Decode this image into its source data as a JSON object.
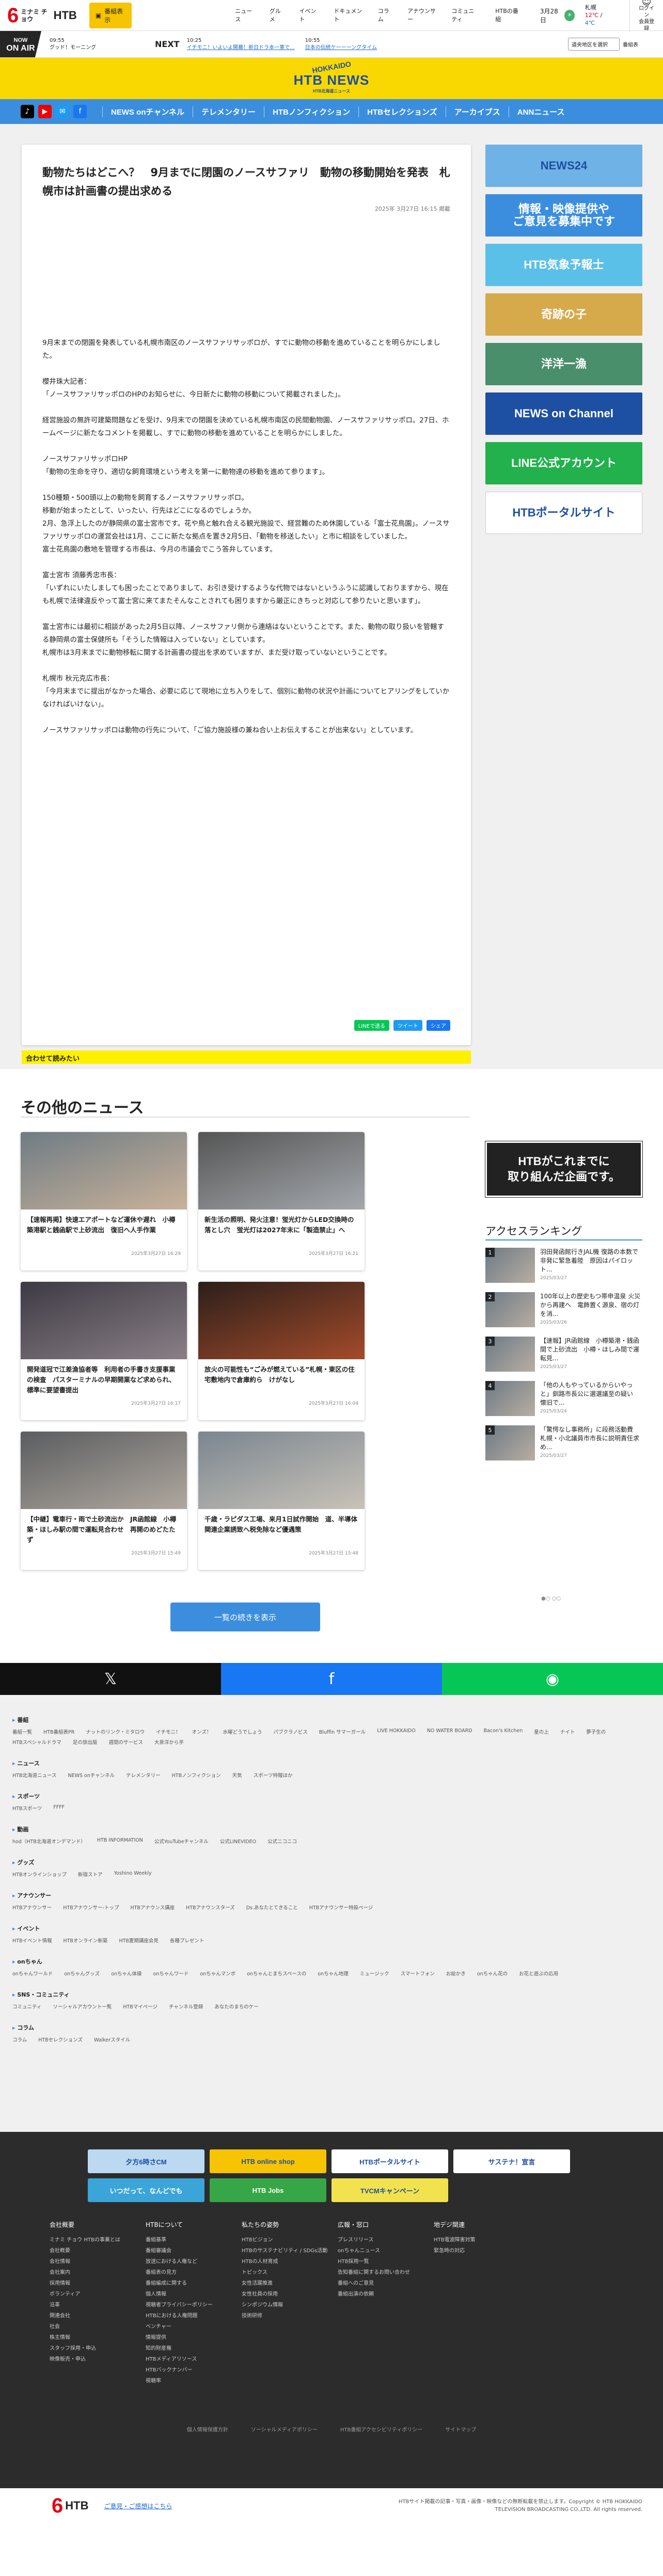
{
  "header": {
    "logo_num": "6",
    "logo_text": "ミナミ チョウ",
    "logo_htb": "HTB",
    "display_btn": "番組表示",
    "nav": [
      "ニュース",
      "グルメ",
      "イベント",
      "ドキュメント",
      "コラム",
      "アナウンサー",
      "コミュニティ",
      "HTBの番組"
    ],
    "date": "3月28日",
    "weather_city": "札幌",
    "weather_hi": "12℃",
    "weather_lo": "4℃",
    "weather_note": "降水確率",
    "login_label": "ログイン",
    "login_sub": "会員登録"
  },
  "onair": {
    "now": "NOW",
    "label": "ON AIR",
    "cur_time": "09:55",
    "cur_title": "グッド！モーニング",
    "next": "NEXT",
    "next_items": [
      {
        "time": "10:25",
        "title": "イチモニ！いよいよ開幕！新日ドラ本一軍で...",
        "sub": ""
      },
      {
        "time": "10:55",
        "title": "日本の伝統ケ一ーーングタイム",
        "sub": ""
      }
    ],
    "select": "道央地区を選択",
    "select_btn": "番組表"
  },
  "band": {
    "hokkaido": "HOKKAIDO",
    "name": "HTB NEWS",
    "sub": "HTB北海道ニュース"
  },
  "bnav": {
    "links": [
      "NEWS onチャンネル",
      "テレメンタリー",
      "HTBノンフィクション",
      "HTBセレクションズ",
      "アーカイブス",
      "ANNニュース"
    ]
  },
  "article": {
    "title": "動物たちはどこへ？　9月までに閉園のノースサファリ　動物の移動開始を発表　札幌市は計画書の提出求める",
    "date": "2025年 3月27日 16:15 掲載",
    "paragraphs": [
      "9月末までの閉園を発表している札幌市南区のノースサファリサッポロが、すでに動物の移動を進めていることを明らかにしました。",
      "櫻井珠大記者：\n「ノースサファリサッポロのHPのお知らせに、今日新たに動物の移動について掲載されました」。",
      "経営施設の無許可建築問題などを受け、9月末での閉園を決めている札幌市南区の民間動物園、ノースサファリサッポロ。27日、ホームページに新たなコメントを掲載し、すでに動物の移動を進めていることを明らかにしました。",
      "ノースサファリサッポロHP\n「動物の生命を守り、適切な飼育環境という考えを第一に動物達の移動を進めて参ります」。",
      "150種類・500頭以上の動物を飼育するノースサファリサッポロ。\n移動が始まったとして、いったい、行先はどこになるのでしょうか。\n2月、急浮上したのが静岡県の富士宮市です。花や鳥と触れ合える観光施設で、経営難のため休園している「富士花鳥園」。ノースサファリサッポロの運営会社は1月、ここに新たな拠点を置き2月5日、「動物を移送したい」と市に相談をしていました。\n富士花鳥園の敷地を管理する市長は、今月の市議会でこう答弁しています。",
      "富士宮市 須藤秀忠市長：\n「いずれにいたしましても困ったことでありまして、お引き受けするような代物ではないというふうに認識しておりますから、現在も札幌で法律違反やって富士宮に来てまたそんなことされても困りますから厳正にきちっと対応して参りたいと思います」。",
      "富士宮市には最初に相談があった2月5日以降、ノースサファリ側から連絡はないということです。また、動物の取り扱いを管轄する静岡県の富士保健所も「そうした情報は入っていない」としています。\n札幌市は3月末までに動物移転に関する計画書の提出を求めていますが、まだ受け取っていないということです。",
      "札幌市 秋元克広市長：\n「今月末までに提出がなかった場合、必要に応じて現地に立ち入りをして、個別に動物の状況や計画についてヒアリングをしていかなければいけない」。",
      "ノースサファリサッポロは動物の行先について、「ご協力施設様の兼ね合い上お伝えすることが出来ない」としています。"
    ],
    "share": [
      "LINEで送る",
      "ツイート",
      "シェア"
    ],
    "also": "合わせて読みたい"
  },
  "sidebar": {
    "banners": [
      {
        "label": "NEWS24",
        "bg": "#6fb2e6"
      },
      {
        "label": "情報・映像提供や\nご意見を募集中です",
        "bg": "#3b8ede"
      },
      {
        "label": "HTB気象予報士",
        "bg": "#5bc0e8"
      },
      {
        "label": "奇跡の子",
        "bg": "#d6a94a"
      },
      {
        "label": "洋洋一漁",
        "bg": "#4a8f6c"
      },
      {
        "label": "NEWS on Channel",
        "bg": "#1d4fa3"
      },
      {
        "label": "LINE公式アカウント",
        "bg": "#22b14c"
      },
      {
        "label": "HTBポータルサイト",
        "bg": "#ffffff"
      }
    ]
  },
  "other": {
    "heading": "その他のニュース",
    "cards": [
      {
        "title": "【速報再掲】快速エアポートなど運休や遅れ　小樽築港駅と銭函駅で上砂流出　復旧へ人手作業",
        "date": "2025年3月27日 16:29",
        "c1": "#6f7c84",
        "c2": "#c9b29a"
      },
      {
        "title": "新生活の照明、発火注意！蛍光灯からLED交換時の落とし穴　蛍光灯は2027年末に「製造禁止」へ",
        "date": "2025年3月27日 16:21",
        "c1": "#555",
        "c2": "#a4a8ad"
      },
      {
        "title": "開発道冠で江差漁協者等　利用者の手書き支援事業の検査　パスターミナルの早期開業など求められ、標準に要望書提出",
        "date": "2025年3月27日 16:17",
        "c1": "#3d3a44",
        "c2": "#8a7f87"
      },
      {
        "title": "放火の可能性も“ごみが燃えている”札幌・東区の住宅敷地内で倉庫約ら　けがなし",
        "date": "2025年3月27日 16:04",
        "c1": "#2c1f1a",
        "c2": "#a34b2a"
      },
      {
        "title": "【中継】電車行・雨で土砂流出か　JR函館線　小樽築・ほしみ駅の間で運転見合わせ　再開のめどたたず",
        "date": "2025年3月27日 15:49",
        "c1": "#5b5d60",
        "c2": "#b0a89f"
      },
      {
        "title": "千歳・ラピダス工場、来月1日試作開始　道、半導体関連企業誘致へ税免除など優遇策",
        "date": "2025年3月27日 15:48",
        "c1": "#7b8690",
        "c2": "#c8c2b8"
      }
    ],
    "more": "一覧の続きを表示",
    "promo": "HTBがこれまでに\n取り組んだ企画です。",
    "dots": "●○ ○○",
    "ranking_title": "アクセスランキング",
    "ranking": [
      {
        "num": "1",
        "title": "羽田発函館行きJAL機 復路の本数で非発に緊急着陸　原因はパイロット...",
        "date": "2025/03/27"
      },
      {
        "num": "2",
        "title": "100年以上の歴史もつ帯申温泉 火災から再建へ　電飾置く源泉、宿の灯を消...",
        "date": "2025/03/26"
      },
      {
        "num": "3",
        "title": "【速報】JR函館線　小樽築港・銭函間で上砂流出　小樽・ほしみ間で運転見...",
        "date": "2025/03/27"
      },
      {
        "num": "4",
        "title": "「他の人もやっているからいやっと」釧路市長公に選選議至の疑い　懐旧で...",
        "date": "2025/03/24"
      },
      {
        "num": "5",
        "title": "「驚愕なし事務所」に段務活動費　札幌・小北議員市市長に説明責任求め...",
        "date": "2025/03/27"
      }
    ]
  },
  "footer": {
    "sections": [
      {
        "h": "番組",
        "l": [
          "番組一覧",
          "HTB番組表PR",
          "ナットのリンク・ミタロウ",
          "イチモニ！",
          "オンズ！",
          "水曜どうでしょう",
          "パブクラノビス",
          "Bluffin サマーガール",
          "LIVE HOKKAIDO",
          "NO WATER BOARD",
          "Bacon's Kitchen",
          "星の上",
          "ナイト",
          "夢子生の",
          "HTBスペシャルドラマ",
          "足の旅出版",
          "週間のサービス",
          "大泉洋から芋"
        ]
      },
      {
        "h": "ニュース",
        "l": [
          "HTB北海道ニュース",
          "NEWS onチャンネル",
          "テレメンタリー",
          "HTBノンフィクション",
          "天気",
          "スポーツ特報ほか"
        ]
      },
      {
        "h": "スポーツ",
        "l": [
          "HTBスポーツ",
          "FFFF"
        ]
      },
      {
        "h": "動画",
        "l": [
          "hod（HTB北海道オンデマンド）",
          "HTB INFORMATION",
          "公式YouTubeチャンネル",
          "公式LINEVIDEO",
          "公式ニコニコ"
        ]
      },
      {
        "h": "グッズ",
        "l": [
          "HTBオンラインショップ",
          "新宿ストア",
          "Yoshino Weekly"
        ]
      },
      {
        "h": "アナウンサー",
        "l": [
          "HTBアナウンサー",
          "HTBアナウンサー-トップ",
          "HTBアナウンス講座",
          "HTBアナウンスターズ",
          "Ds.あなたとてきること",
          "HTBアナウンサー特設ページ"
        ]
      },
      {
        "h": "イベント",
        "l": [
          "HTBイベント情報",
          "HTBオンライン新築",
          "HTB夏期講座会見",
          "各種プレゼント"
        ]
      },
      {
        "h": "onちゃん",
        "l": [
          "onちゃんワールド",
          "onちゃんグッズ",
          "onちゃん体操",
          "onちゃんワード",
          "onちゃんマンボ",
          "onちゃんとまちスペースの",
          "onちゃん地理",
          "ミュージック",
          "スマートフォン",
          "お絵かき",
          "onちゃん花の",
          "お花と遊ぶの応用"
        ]
      },
      {
        "h": "SNS・コミュニティ",
        "l": [
          "コミュニティ",
          "ソーシャルアカウント一覧",
          "HTBマイページ",
          "チャンネル登録",
          "あなたのまちのケー"
        ]
      },
      {
        "h": "コラム",
        "l": [
          "コラム",
          "HTBセレクションズ",
          "Walkerスタイル"
        ]
      }
    ],
    "dark_banners": [
      {
        "label": "夕方6時さCM",
        "bg": "#bcd9f2"
      },
      {
        "label": "HTB online shop",
        "bg": "#f6c400"
      },
      {
        "label": "HTBポータルサイト",
        "bg": "#ffffff"
      },
      {
        "label": "サステナ！宣言",
        "bg": "#ffffff"
      },
      {
        "label": "いつだって、なんどでも",
        "bg": "#3ba4d8"
      },
      {
        "label": "HTB Jobs",
        "bg": "#36a647"
      },
      {
        "label": "TVCMキャンペーン",
        "bg": "#f2e34e"
      }
    ],
    "cols": [
      {
        "h": "会社概要",
        "items": [
          "ミナミ チョウ HTBの事業とは",
          "会社概要",
          "会社情報",
          "会社案内",
          "採用情報",
          "ボランティア",
          "沿革",
          "関連会社",
          "社会",
          "株主情報",
          "スタッフ採用・申込",
          "映像販売・申込"
        ]
      },
      {
        "h": "HTBについて",
        "items": [
          "番組基準",
          "番組審議会",
          "放送における人権など",
          "番組表の見方",
          "番組編成に関する",
          "個人情報",
          "視聴者プライバシーポリシー",
          "HTBにおける人権問題",
          "ベンチャー",
          "情報提供",
          "知的財産権",
          "HTBメディアリソース",
          "HTBバックナンバー",
          "視聴率"
        ]
      },
      {
        "h": "私たちの姿勢",
        "items": [
          "HTBビジョン",
          "HTBのサステナビリティ / SDGs活動",
          "HTBの人材育成",
          "トピックス",
          "女性活躍推進",
          "女性社員の採用",
          "シンポジウム情報",
          "技術研修"
        ]
      },
      {
        "h": "広報・窓口",
        "items": [
          "プレスリリース",
          "onちゃんニュース",
          "HTB採用一覧",
          "告知番組に関するお問い合わせ",
          "番組へのご意見",
          "番組出演の依頼"
        ]
      },
      {
        "h": "地デジ関連",
        "items": [
          "HTB電波障害対策",
          "緊急時の対応"
        ]
      }
    ],
    "bottom": [
      "個人情報保護方針",
      "ソーシャルメディアポリシー",
      "HTB番組アクセシビリティポリシー",
      "サイトマップ"
    ],
    "bottom_link": "ご意見・ご感想はこちら",
    "copyright": "HTBサイト掲載の記事・写真・画像・映像などの無断転載を禁止します。Copyright © HTB HOKKAIDO TELEVISION BROADCASTING CO.,LTD. All rights reserved."
  }
}
